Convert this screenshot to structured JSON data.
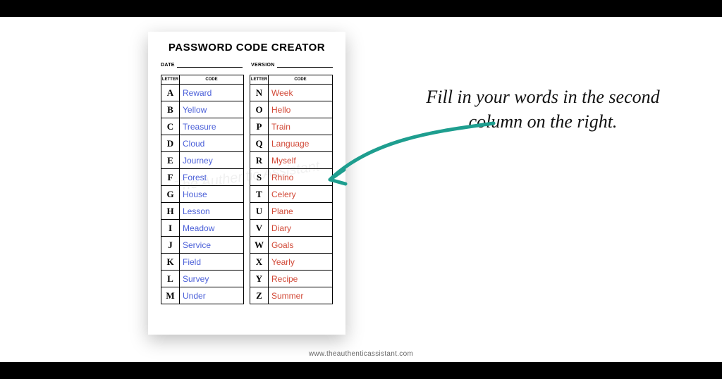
{
  "title": "PASSWORD CODE CREATOR",
  "meta": {
    "date_label": "DATE",
    "version_label": "VERSION"
  },
  "headers": {
    "letter": "LETTER",
    "code": "CODE"
  },
  "left_col": [
    {
      "letter": "A",
      "code": "Reward"
    },
    {
      "letter": "B",
      "code": "Yellow"
    },
    {
      "letter": "C",
      "code": "Treasure"
    },
    {
      "letter": "D",
      "code": "Cloud"
    },
    {
      "letter": "E",
      "code": "Journey"
    },
    {
      "letter": "F",
      "code": "Forest"
    },
    {
      "letter": "G",
      "code": "House"
    },
    {
      "letter": "H",
      "code": "Lesson"
    },
    {
      "letter": "I",
      "code": "Meadow"
    },
    {
      "letter": "J",
      "code": "Service"
    },
    {
      "letter": "K",
      "code": "Field"
    },
    {
      "letter": "L",
      "code": "Survey"
    },
    {
      "letter": "M",
      "code": "Under"
    }
  ],
  "right_col": [
    {
      "letter": "N",
      "code": "Week"
    },
    {
      "letter": "O",
      "code": "Hello"
    },
    {
      "letter": "P",
      "code": "Train"
    },
    {
      "letter": "Q",
      "code": "Language"
    },
    {
      "letter": "R",
      "code": "Myself"
    },
    {
      "letter": "S",
      "code": "Rhino"
    },
    {
      "letter": "T",
      "code": "Celery"
    },
    {
      "letter": "U",
      "code": "Plane"
    },
    {
      "letter": "V",
      "code": "Diary"
    },
    {
      "letter": "W",
      "code": "Goals"
    },
    {
      "letter": "X",
      "code": "Yearly"
    },
    {
      "letter": "Y",
      "code": "Recipe"
    },
    {
      "letter": "Z",
      "code": "Summer"
    }
  ],
  "watermark": "The Authentic Assistant",
  "callout": "Fill in your words in the second column on the right.",
  "footer": "www.theauthenticassistant.com"
}
